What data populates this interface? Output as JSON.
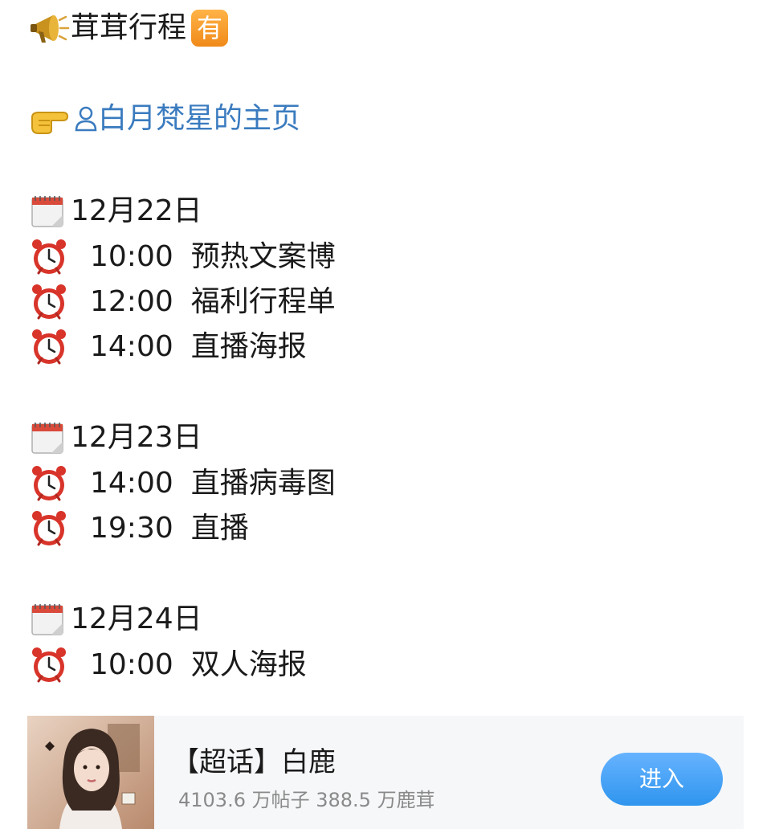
{
  "post": {
    "title": "茸茸行程",
    "badge": "有",
    "link_text": "白月梵星的主页",
    "icons": {
      "title": "megaphone-icon",
      "link_pointer": "pointing-right-hand-icon",
      "link_person": "person-icon",
      "date": "calendar-icon",
      "time": "alarm-clock-icon"
    },
    "days": [
      {
        "date": "12月22日",
        "events": [
          {
            "time": "10:00",
            "text": "预热文案博"
          },
          {
            "time": "12:00",
            "text": "福利行程单"
          },
          {
            "time": "14:00",
            "text": "直播海报"
          }
        ]
      },
      {
        "date": "12月23日",
        "events": [
          {
            "time": "14:00",
            "text": "直播病毒图"
          },
          {
            "time": "19:30",
            "text": "直播"
          }
        ]
      },
      {
        "date": "12月24日",
        "events": [
          {
            "time": "10:00",
            "text": "双人海报"
          }
        ]
      }
    ]
  },
  "card": {
    "title": "【超话】白鹿",
    "stats": "4103.6 万帖子  388.5 万鹿茸",
    "button_label": "进入"
  },
  "colors": {
    "link": "#3a7bbf",
    "badge": "#f39a2c",
    "button": "#3b9bf0",
    "card_bg": "#f6f7f9"
  }
}
